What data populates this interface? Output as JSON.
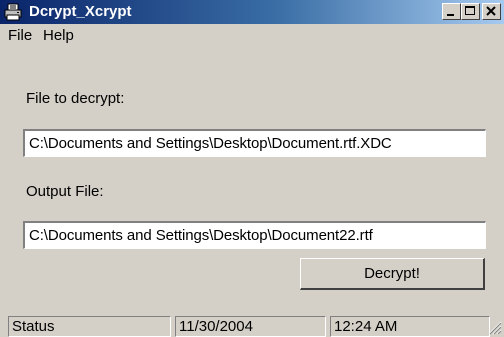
{
  "window": {
    "title": "Dcrypt_Xcrypt",
    "icon": "printer-icon",
    "controls": [
      "minimize-icon",
      "maximize-icon",
      "close-icon"
    ]
  },
  "menu": {
    "file": "File",
    "help": "Help"
  },
  "form": {
    "decrypt_label": "File to decrypt:",
    "decrypt_value": "C:\\Documents and Settings\\Desktop\\Document.rtf.XDC",
    "output_label": "Output File:",
    "output_value": "C:\\Documents and Settings\\Desktop\\Document22.rtf",
    "decrypt_button": "Decrypt!"
  },
  "status": {
    "text": "Status",
    "date": "11/30/2004",
    "time": "12:24 AM"
  },
  "colors": {
    "titlebar_start": "#0a246a",
    "titlebar_end": "#a6caf0",
    "face": "#d4d0c8"
  }
}
